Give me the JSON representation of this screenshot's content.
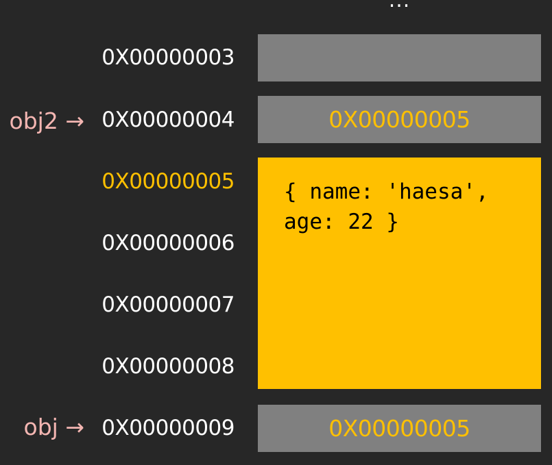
{
  "ellipsis": "...",
  "colors": {
    "background": "#272727",
    "cell_gray": "#808080",
    "highlight": "#ffc000",
    "pointer_label": "#f4b6b2",
    "address_text": "#ffffff"
  },
  "rows": [
    {
      "address": "0X00000003",
      "value": ""
    },
    {
      "address": "0X00000004",
      "value": "0X00000005",
      "pointer": "obj2 →"
    },
    {
      "address": "0X00000005",
      "highlighted": true
    },
    {
      "address": "0X00000006"
    },
    {
      "address": "0X00000007"
    },
    {
      "address": "0X00000008"
    },
    {
      "address": "0X00000009",
      "value": "0X00000005",
      "pointer": "obj →"
    }
  ],
  "object_block": {
    "content": "{ name: 'haesa', age: 22 }"
  }
}
